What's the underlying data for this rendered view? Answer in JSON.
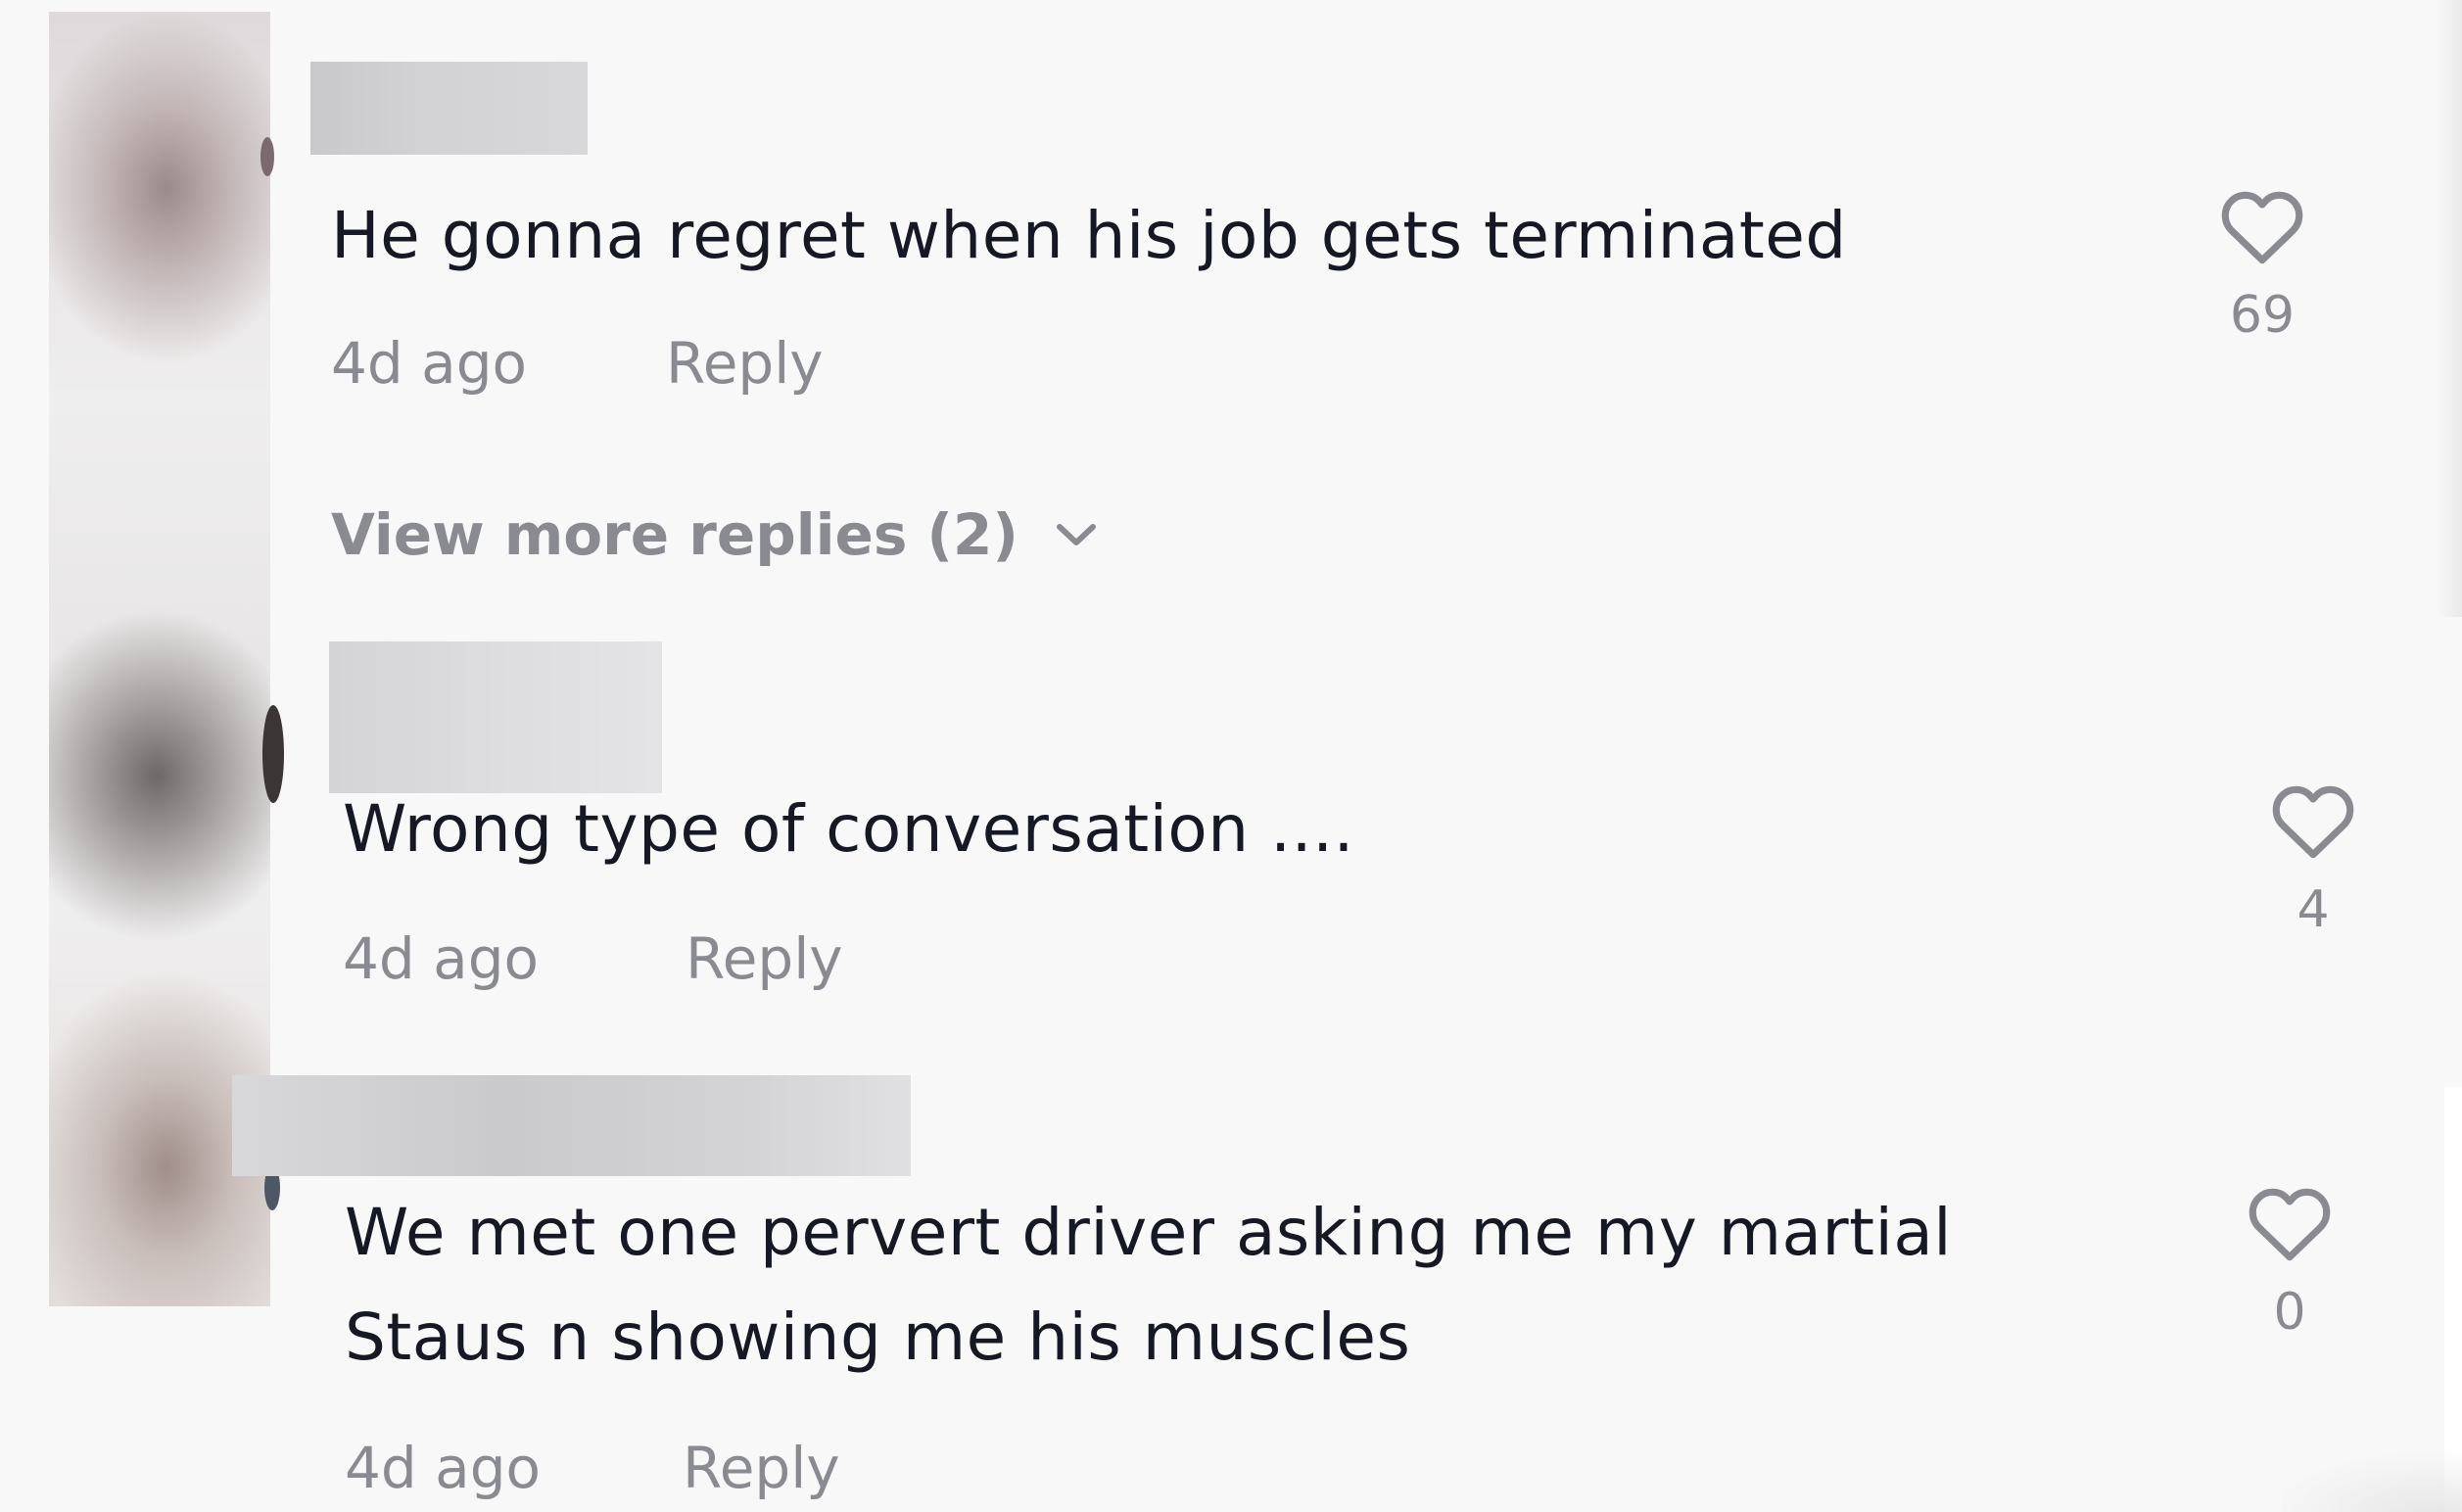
{
  "comments": [
    {
      "text": "He gonna regret when his job gets terminated",
      "time": "4d ago",
      "reply_label": "Reply",
      "likes": "69"
    },
    {
      "text": "Wrong type of conversation ....",
      "time": "4d ago",
      "reply_label": "Reply",
      "likes": "4"
    },
    {
      "text_line1": "We met one pervert driver asking me my martial",
      "text_line2": "Staus n showing me his muscles",
      "time": "4d ago",
      "reply_label": "Reply",
      "likes": "0"
    }
  ],
  "view_more_replies": "View more replies (2)",
  "icons": {
    "like": "heart-outline-icon",
    "expand": "chevron-down-icon"
  },
  "colors": {
    "background": "#f8f8f8",
    "text": "#161823",
    "secondary_text": "#8a8b91"
  }
}
